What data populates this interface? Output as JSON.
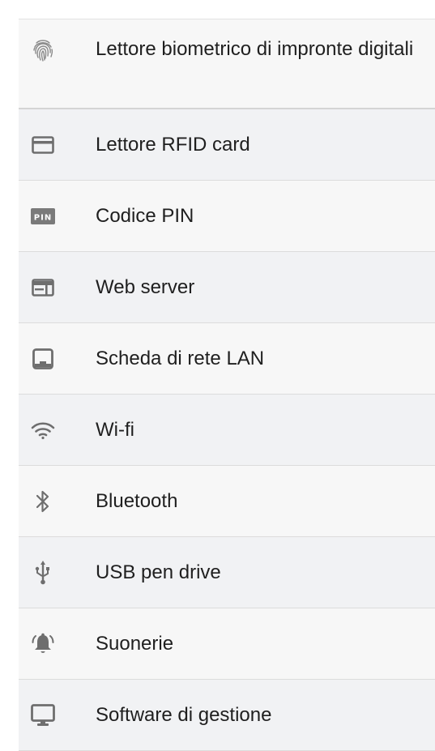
{
  "features": {
    "items": [
      {
        "label": "Lettore biometrico di impronte digitali",
        "icon": "fingerprint-icon"
      },
      {
        "label": "Lettore RFID card",
        "icon": "rfid-card-icon"
      },
      {
        "label": "Codice PIN",
        "icon": "pin-icon",
        "icon_text": "PIN"
      },
      {
        "label": "Web server",
        "icon": "web-server-icon"
      },
      {
        "label": "Scheda di rete LAN",
        "icon": "lan-icon"
      },
      {
        "label": "Wi-fi",
        "icon": "wifi-icon"
      },
      {
        "label": "Bluetooth",
        "icon": "bluetooth-icon"
      },
      {
        "label": "USB pen drive",
        "icon": "usb-icon"
      },
      {
        "label": "Suonerie",
        "icon": "bell-icon"
      },
      {
        "label": "Software di gestione",
        "icon": "monitor-icon"
      }
    ]
  },
  "colors": {
    "icon": "#6e6e6e",
    "text": "#1f1f1f",
    "row_background": "#f7f7f7",
    "divider": "#dcdcdc"
  }
}
